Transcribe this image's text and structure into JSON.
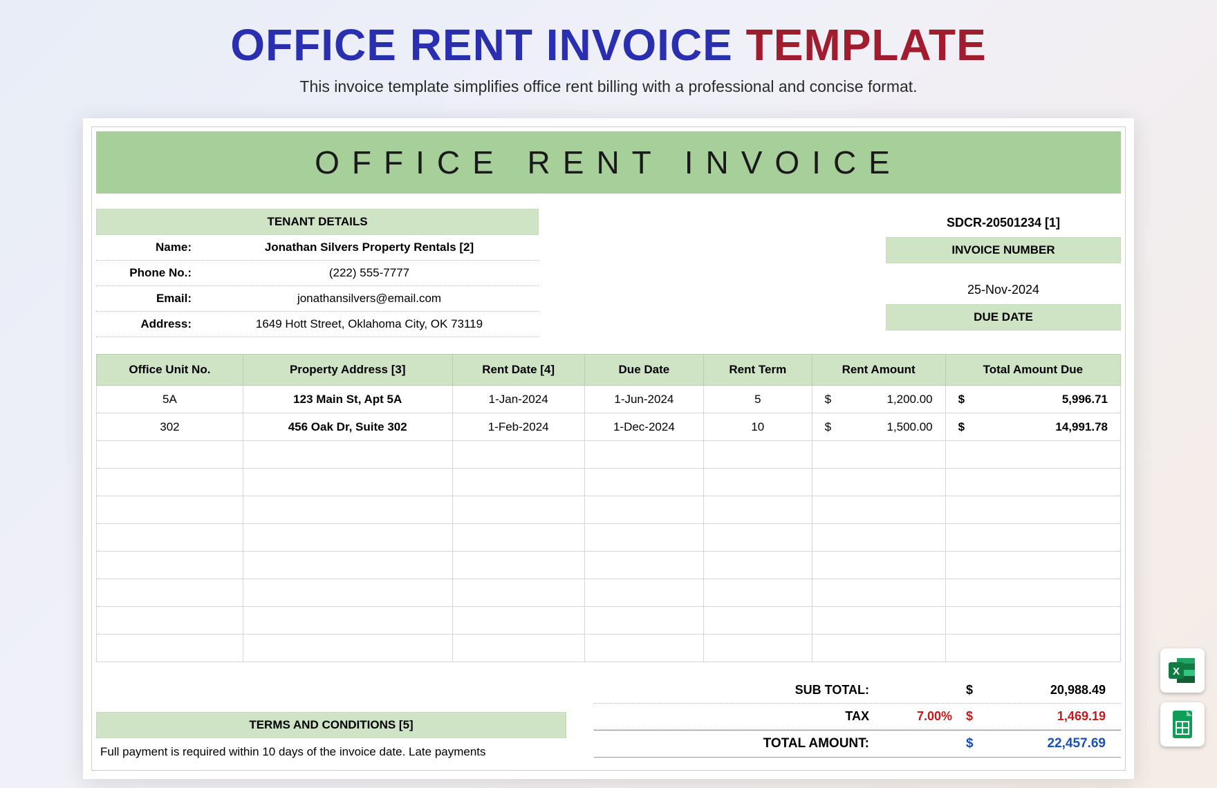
{
  "header": {
    "title_part1": "OFFICE RENT INVOICE",
    "title_part2": "TEMPLATE",
    "subtitle": "This invoice template simplifies office rent billing with a professional and concise format."
  },
  "banner": "OFFICE RENT INVOICE",
  "tenant": {
    "section": "TENANT DETAILS",
    "labels": {
      "name": "Name:",
      "phone": "Phone No.:",
      "email": "Email:",
      "address": "Address:"
    },
    "name": "Jonathan Silvers Property Rentals  [2]",
    "phone": "(222) 555-7777",
    "email": "jonathansilvers@email.com",
    "address": "1649 Hott Street, Oklahoma City, OK 73119"
  },
  "meta": {
    "invoice_value": "SDCR-20501234 [1]",
    "invoice_label": "INVOICE NUMBER",
    "due_value": "25-Nov-2024",
    "due_label": "DUE DATE"
  },
  "table": {
    "headers": [
      "Office Unit No.",
      "Property Address [3]",
      "Rent Date [4]",
      "Due Date",
      "Rent Term",
      "Rent Amount",
      "Total Amount Due"
    ],
    "rows": [
      {
        "unit": "5A",
        "addr": "123 Main St, Apt 5A",
        "rent_date": "1-Jan-2024",
        "due_date": "1-Jun-2024",
        "term": "5",
        "amount": "1,200.00",
        "total": "5,996.71"
      },
      {
        "unit": "302",
        "addr": "456 Oak Dr, Suite 302",
        "rent_date": "1-Feb-2024",
        "due_date": "1-Dec-2024",
        "term": "10",
        "amount": "1,500.00",
        "total": "14,991.78"
      }
    ],
    "empty_rows": 8
  },
  "totals": {
    "subtotal_label": "SUB TOTAL:",
    "subtotal": "20,988.49",
    "tax_label": "TAX",
    "tax_pct": "7.00%",
    "tax": "1,469.19",
    "total_label": "TOTAL AMOUNT:",
    "total": "22,457.69",
    "currency": "$"
  },
  "terms": {
    "heading": "TERMS AND CONDITIONS [5]",
    "body": "Full payment is required within 10 days of the invoice date. Late payments"
  }
}
